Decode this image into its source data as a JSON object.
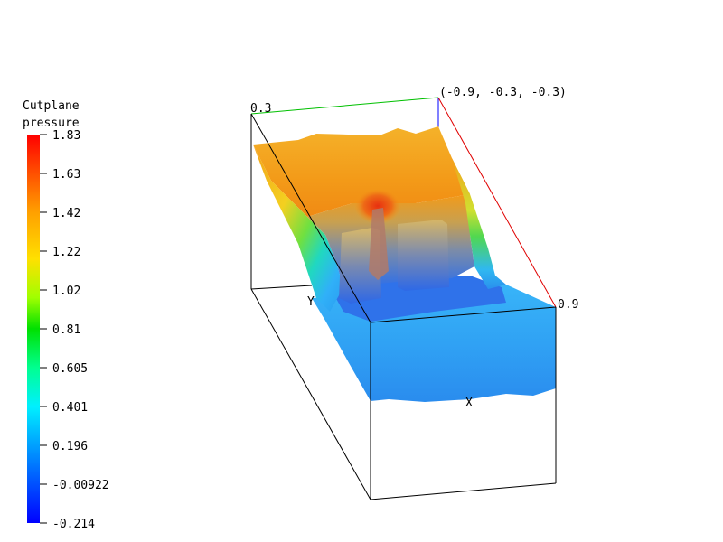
{
  "legend": {
    "title_line1": "Cutplane",
    "title_line2": "pressure",
    "ticks": [
      "1.83",
      "1.63",
      "1.42",
      "1.22",
      "1.02",
      "0.81",
      "0.605",
      "0.401",
      "0.196",
      "-0.00922",
      "-0.214"
    ],
    "colors": [
      "#ff0000",
      "#ff8000",
      "#ffd000",
      "#c0ff00",
      "#00e000",
      "#00ffa0",
      "#00e0ff",
      "#00a0ff",
      "#0040ff",
      "#0000ff"
    ]
  },
  "axes": {
    "corner_label": "(-0.9, -0.3, -0.3)",
    "top_label": "0.3",
    "right_label": "0.9",
    "x_label": "X",
    "y_label": "Y"
  },
  "surface_colors": {
    "high": "#f2a21a",
    "peak": "#e83a12",
    "mid": "#e0d020",
    "green": "#40d040",
    "low": "#2c8cf0",
    "lowest": "#1f5fe0",
    "floor": "#35a8f6"
  }
}
